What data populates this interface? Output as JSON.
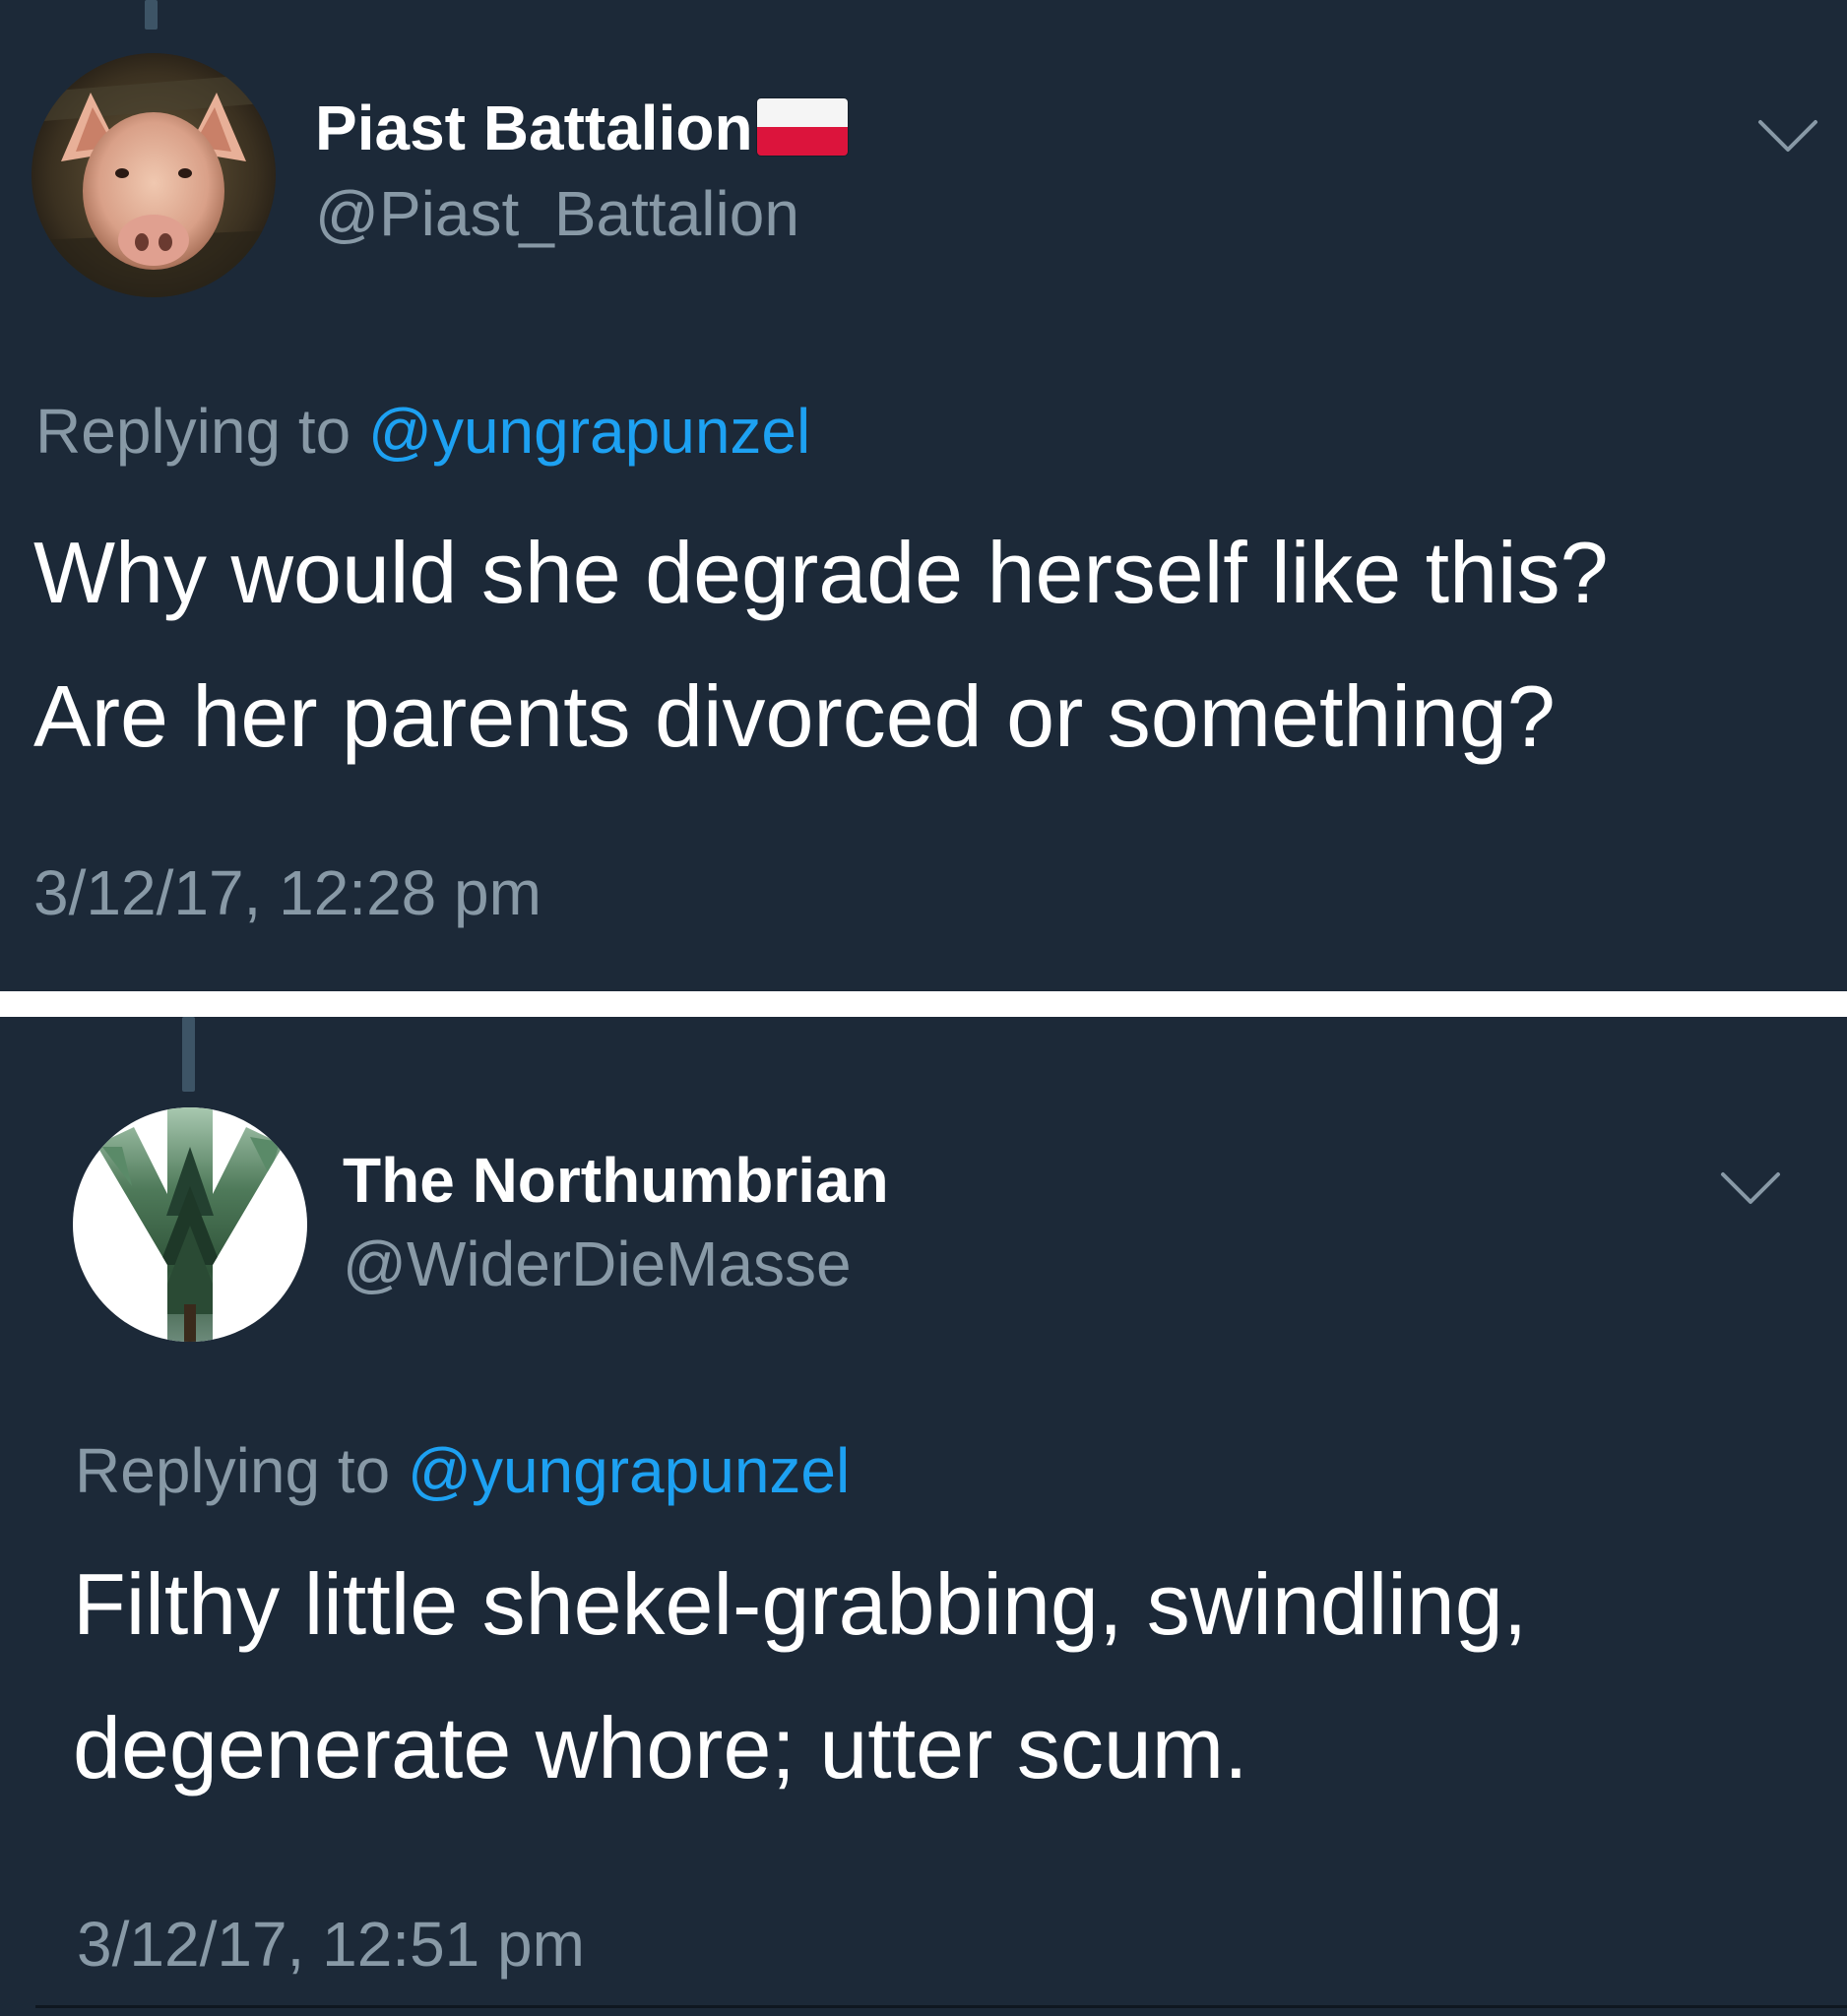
{
  "tweets": [
    {
      "display_name": "Piast Battalion",
      "flag_icon": "poland-flag-emoji",
      "handle": "@Piast_Battalion",
      "avatar_icon": "pig-avatar",
      "menu_icon": "chevron-down-icon",
      "replying_prefix": "Replying to",
      "replying_to": "@yungrapunzel",
      "text_lines": [
        "Why would she degrade herself like this?",
        "Are her parents divorced or something?"
      ],
      "timestamp": "3/12/17, 12:28 pm"
    },
    {
      "display_name": "The Northumbrian",
      "handle": "@WiderDieMasse",
      "avatar_icon": "algiz-rune-forest-avatar",
      "menu_icon": "chevron-down-icon",
      "replying_prefix": "Replying to",
      "replying_to": "@yungrapunzel",
      "text_lines": [
        "Filthy little shekel-grabbing, swindling,",
        "degenerate whore; utter scum."
      ],
      "timestamp": "3/12/17, 12:51 pm"
    }
  ],
  "colors": {
    "background": "#1c2938",
    "name": "#ffffff",
    "secondary": "#8899a6",
    "mention": "#1da1f2",
    "separator": "#ffffff"
  }
}
